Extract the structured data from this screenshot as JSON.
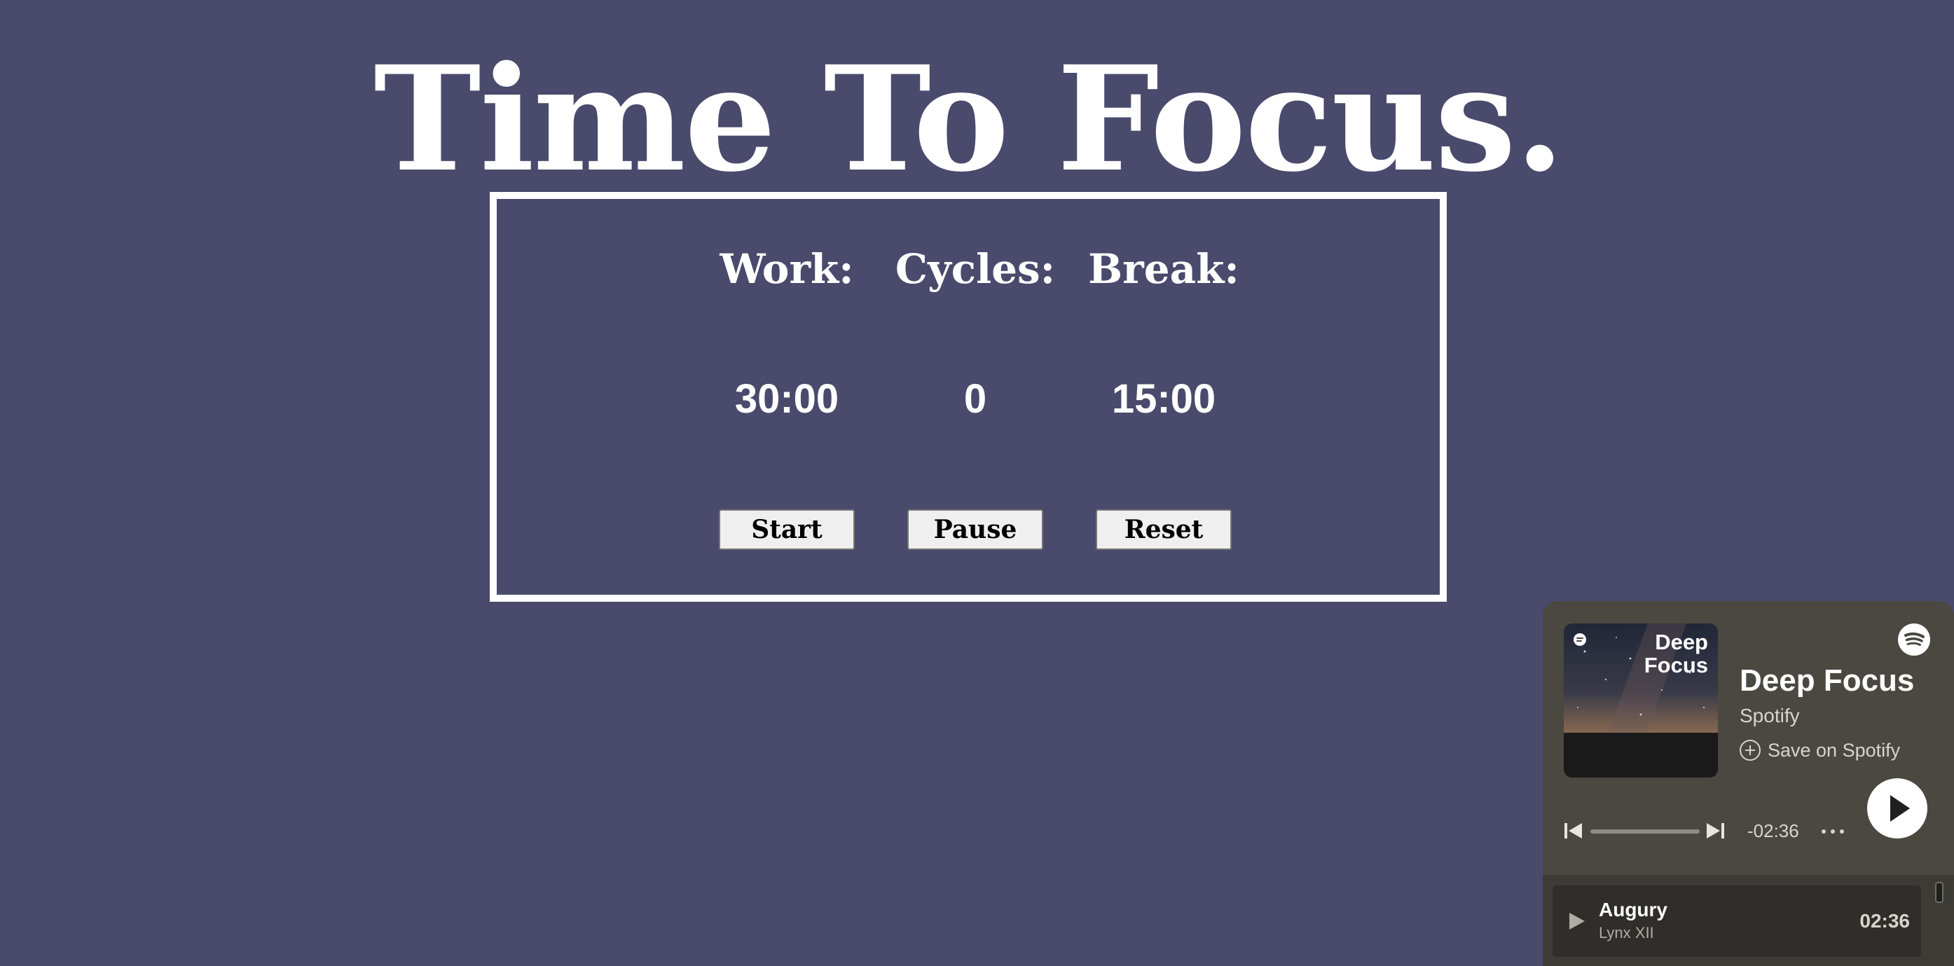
{
  "page": {
    "title": "Time To Focus.",
    "background_color": "#494a6c"
  },
  "timer": {
    "work": {
      "label": "Work:",
      "value": "30:00",
      "button": "Start"
    },
    "cycles": {
      "label": "Cycles:",
      "value": "0",
      "button": "Pause"
    },
    "break": {
      "label": "Break:",
      "value": "15:00",
      "button": "Reset"
    }
  },
  "spotify": {
    "cover_title": "Deep\nFocus",
    "playlist_title": "Deep Focus",
    "owner": "Spotify",
    "save_label": "Save on Spotify",
    "remaining_time": "-02:36",
    "progress": 0,
    "background_color": "#4a4840",
    "icons": {
      "logo": "spotify-logo-icon",
      "play": "play-icon",
      "previous": "skip-previous-icon",
      "next": "skip-next-icon",
      "more": "more-options-icon",
      "save": "plus-circle-icon"
    },
    "tracks": [
      {
        "title": "Augury",
        "artist": "Lynx XII",
        "duration": "02:36"
      }
    ]
  }
}
